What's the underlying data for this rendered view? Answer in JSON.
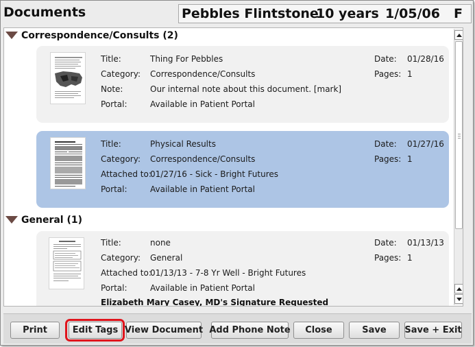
{
  "header": {
    "title": "Documents",
    "patient_name": "Pebbles Flintstone",
    "patient_age": "10 years",
    "patient_dob": "1/05/06",
    "patient_sex": "F"
  },
  "labels": {
    "title": "Title:",
    "category": "Category:",
    "note": "Note:",
    "attached_to": "Attached to:",
    "portal": "Portal:",
    "date": "Date:",
    "pages": "Pages:"
  },
  "sections": [
    {
      "header": "Correspondence/Consults (2)",
      "documents": [
        {
          "title": "Thing For Pebbles",
          "category": "Correspondence/Consults",
          "note": "Our internal note about this document. [mark]",
          "portal": "Available in Patient Portal",
          "date": "01/28/16",
          "pages": "1"
        },
        {
          "title": "Physical Results",
          "category": "Correspondence/Consults",
          "attached_to": "01/27/16 - Sick - Bright Futures",
          "portal": "Available in Patient Portal",
          "date": "01/27/16",
          "pages": "1",
          "selected": true,
          "selection_color": "#adc5e5"
        }
      ]
    },
    {
      "header": "General (1)",
      "documents": [
        {
          "title": "none",
          "category": "General",
          "attached_to": "01/13/13 - 7-8 Yr Well - Bright Futures",
          "portal": "Available in Patient Portal",
          "date": "01/13/13",
          "pages": "1",
          "signature_request": "Elizabeth Mary Casey, MD's Signature Requested"
        }
      ]
    }
  ],
  "buttons": {
    "print": "Print",
    "edit_tags": "Edit Tags",
    "view_document": "View Document",
    "add_phone_note": "Add Phone Note",
    "close": "Close",
    "save": "Save",
    "save_exit": "Save + Exit"
  },
  "colors": {
    "highlight_ring": "#e0141c",
    "section_triangle": "#6b4a44"
  }
}
